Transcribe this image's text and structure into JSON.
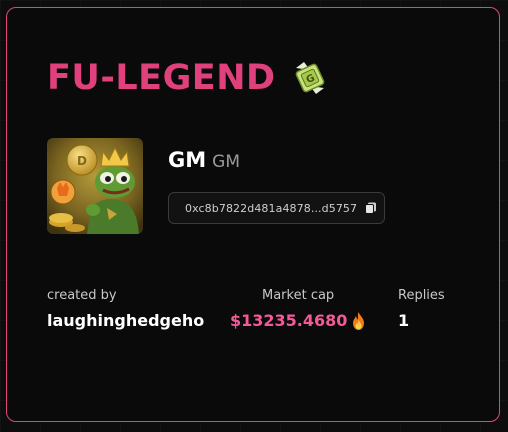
{
  "token": {
    "title": "FU-LEGEND",
    "title_icon": "green-gem-logo-icon",
    "name": "GM",
    "symbol": "GM",
    "address": "0xc8b7822d481a4878...d5757",
    "avatar_icon": "pepe-king-avatar"
  },
  "stats": {
    "created_by_label": "created by",
    "created_by_value": "laughinghedgeho",
    "market_cap_label": "Market cap",
    "market_cap_value": "$13235.4680",
    "market_cap_icon": "fire-icon",
    "replies_label": "Replies",
    "replies_value": "1"
  },
  "colors": {
    "accent": "#e0407c",
    "border": "#e0457b",
    "market_cap": "#f25b98",
    "background": "#0a0a0a"
  }
}
